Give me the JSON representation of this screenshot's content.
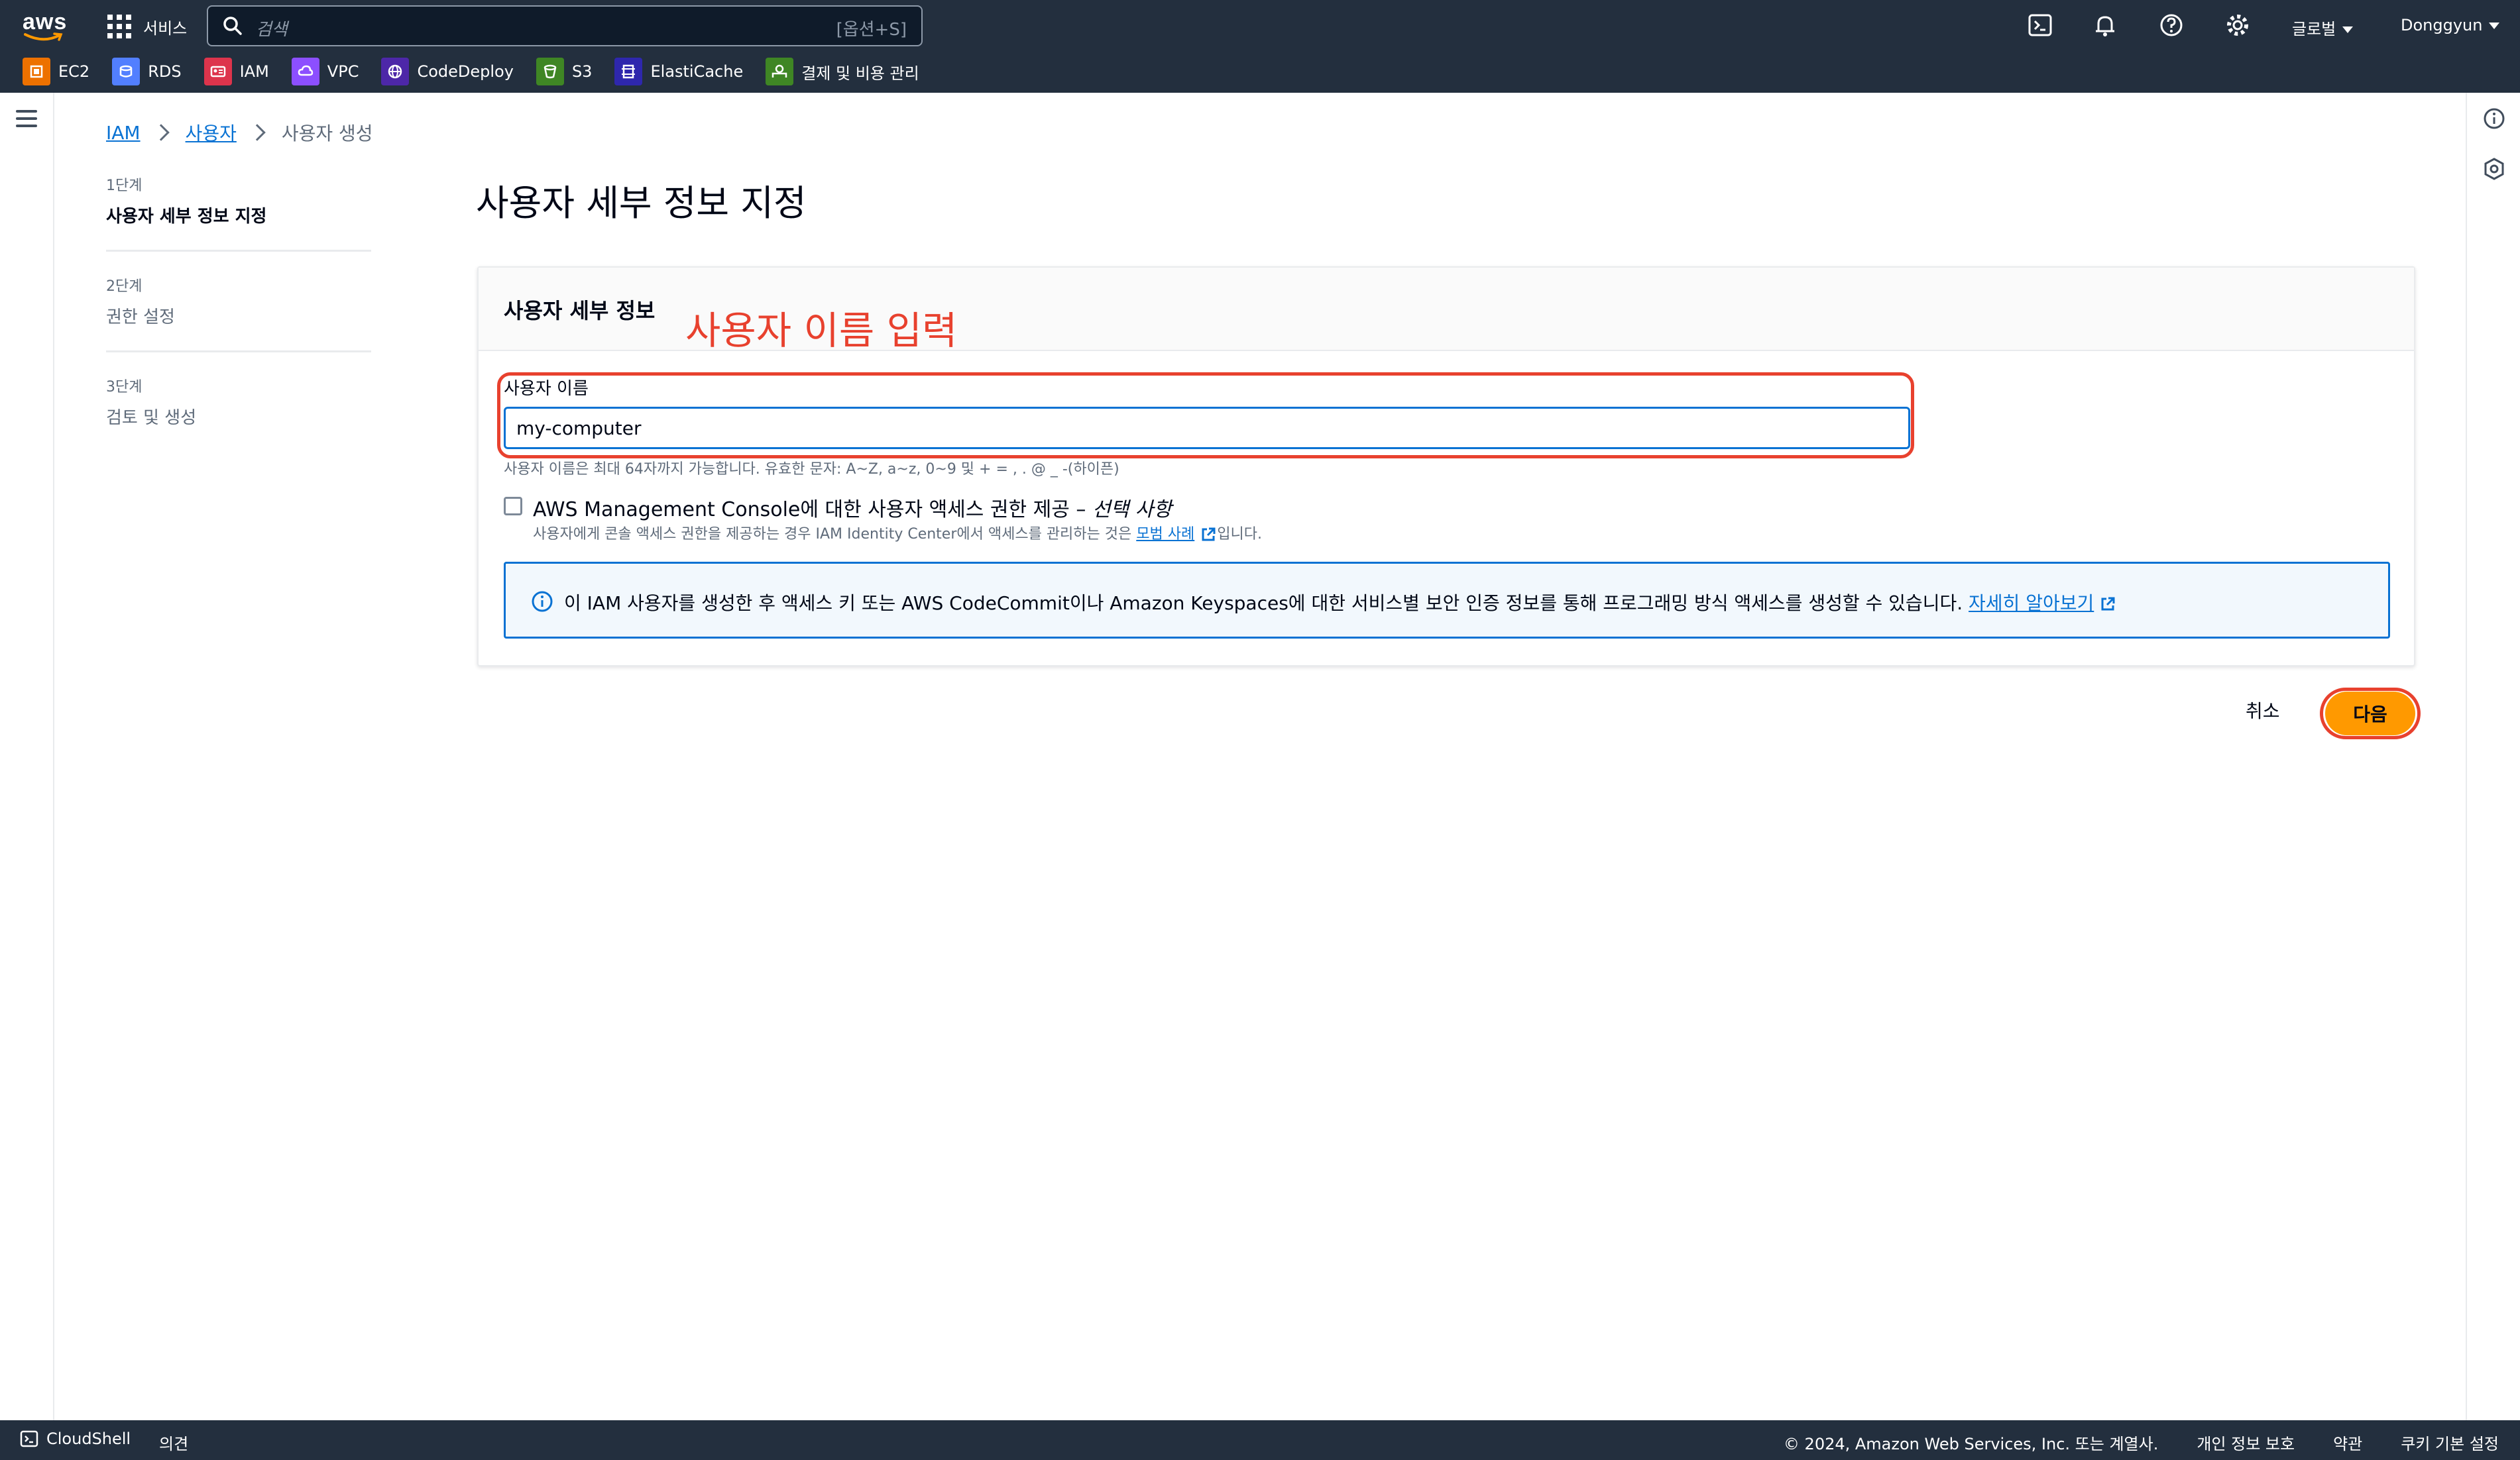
{
  "topbar": {
    "logo_text": "aws",
    "services_label": "서비스",
    "search_placeholder": "검색",
    "search_shortcut": "[옵션+S]",
    "region_label": "글로벌",
    "user_label": "Donggyun",
    "icons": [
      "cloudshell-icon",
      "bell-icon",
      "help-icon",
      "settings-icon"
    ]
  },
  "favorites": [
    {
      "label": "EC2",
      "color": "#ed7100",
      "icon": "ec2-icon"
    },
    {
      "label": "RDS",
      "color": "#527fff",
      "icon": "rds-icon"
    },
    {
      "label": "IAM",
      "color": "#dd344c",
      "icon": "iam-icon"
    },
    {
      "label": "VPC",
      "color": "#8c4fff",
      "icon": "vpc-icon"
    },
    {
      "label": "CodeDeploy",
      "color": "#4d27a8",
      "icon": "codedeploy-icon"
    },
    {
      "label": "S3",
      "color": "#3f8624",
      "icon": "s3-icon"
    },
    {
      "label": "ElastiCache",
      "color": "#2e27ad",
      "icon": "elasticache-icon"
    },
    {
      "label": "결제 및 비용 관리",
      "color": "#3f8624",
      "icon": "billing-icon"
    }
  ],
  "breadcrumb": {
    "items": [
      "IAM",
      "사용자"
    ],
    "current": "사용자 생성"
  },
  "steps": [
    {
      "num": "1단계",
      "name": "사용자 세부 정보 지정",
      "active": true
    },
    {
      "num": "2단계",
      "name": "권한 설정",
      "active": false
    },
    {
      "num": "3단계",
      "name": "검토 및 생성",
      "active": false
    }
  ],
  "main": {
    "title": "사용자 세부 정보 지정",
    "panel_title": "사용자 세부 정보",
    "annotation": "사용자 이름 입력",
    "field_label": "사용자 이름",
    "field_value": "my-computer",
    "constraint": "사용자 이름은 최대 64자까지 가능합니다. 유효한 문자: A~Z, a~z, 0~9 및 + = , . @ _ -(하이픈)",
    "console_label": "AWS Management Console에 대한 사용자 액세스 권한 제공 –",
    "console_optional": "선택 사항",
    "console_checked": false,
    "console_desc_pre": "사용자에게 콘솔 액세스 권한을 제공하는 경우 IAM Identity Center에서 액세스를 관리하는 것은",
    "console_desc_link": "모범 사례",
    "console_desc_post": "입니다.",
    "info_text": "이 IAM 사용자를 생성한 후 액세스 키 또는 AWS CodeCommit이나 Amazon Keyspaces에 대한 서비스별 보안 인증 정보를 통해 프로그래밍 방식 액세스를 생성할 수 있습니다.",
    "info_link": "자세히 알아보기",
    "cancel_label": "취소",
    "next_label": "다음"
  },
  "colors": {
    "topbar_bg": "#232f3e",
    "link": "#0972d3",
    "primary_button": "#ff9900",
    "annotation_red": "#e8412e",
    "info_bg": "#f2f8fd"
  },
  "footer": {
    "cloudshell_label": "CloudShell",
    "feedback_label": "의견",
    "copyright": "© 2024, Amazon Web Services, Inc. 또는 계열사.",
    "privacy": "개인 정보 보호",
    "terms": "약관",
    "cookies": "쿠키 기본 설정"
  }
}
